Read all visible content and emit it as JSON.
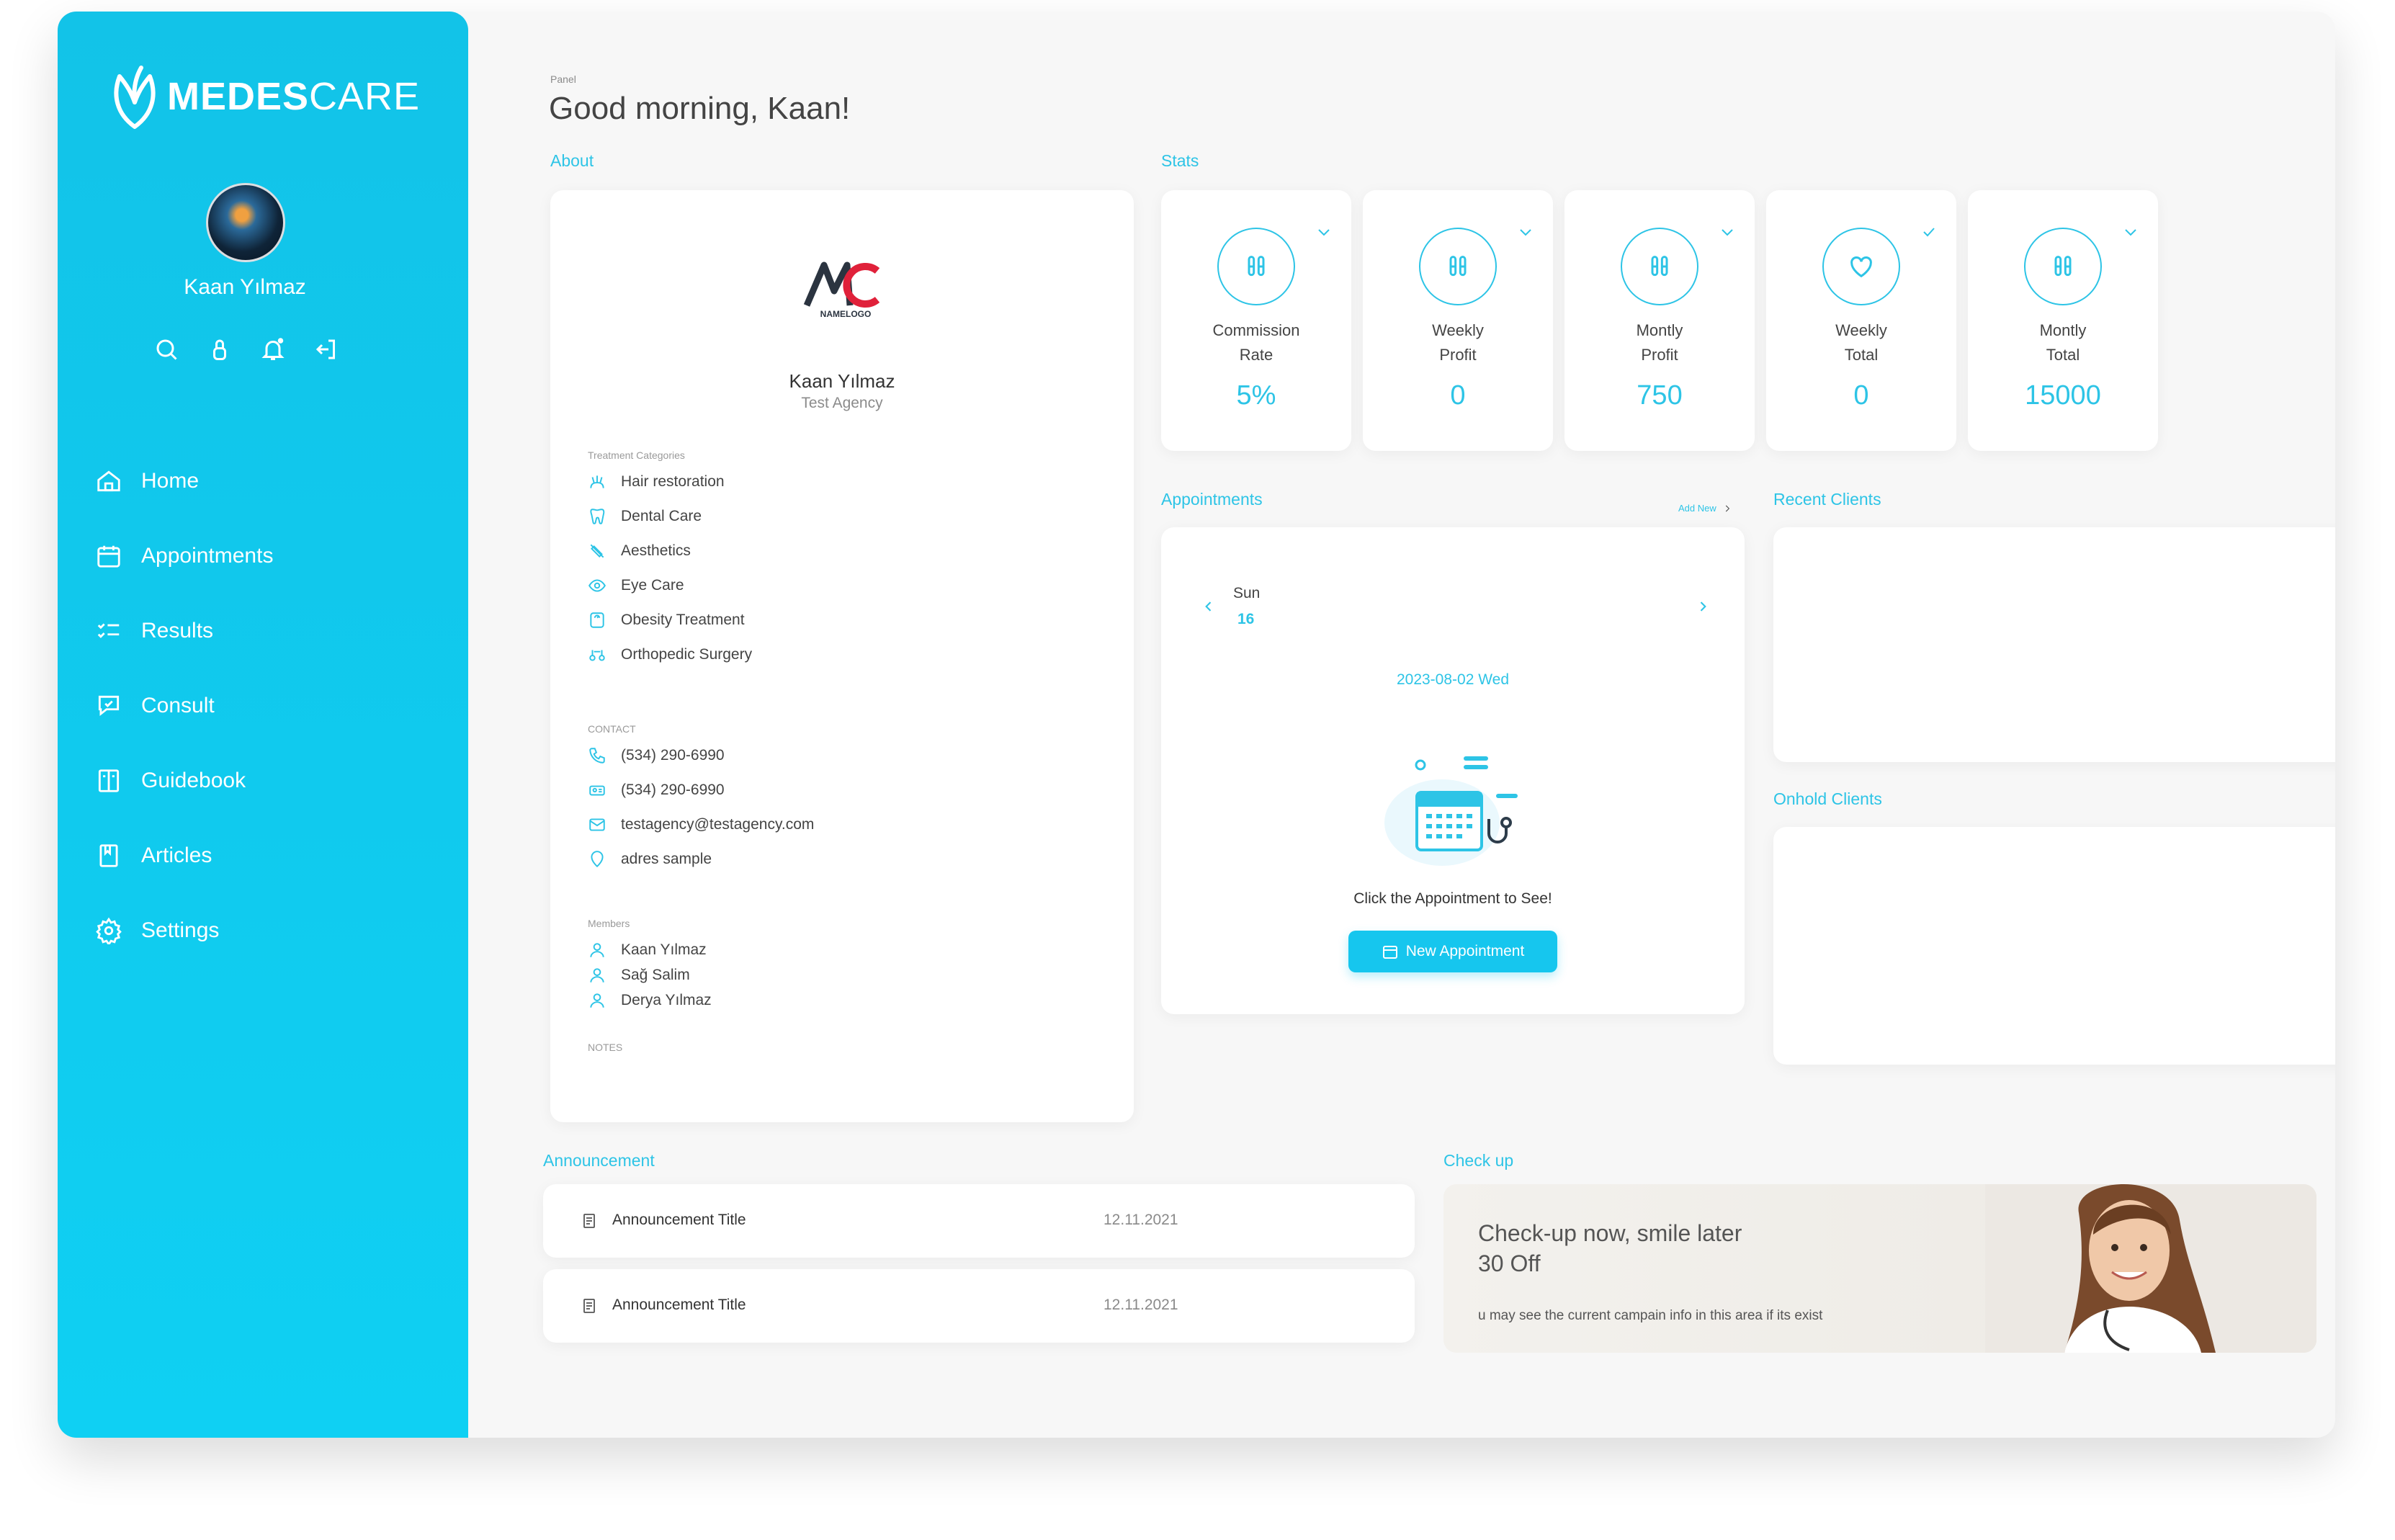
{
  "brand": {
    "name_bold": "MEDES",
    "name_light": "CARE",
    "color": "#12c3e8"
  },
  "user": {
    "name": "Kaan Yılmaz"
  },
  "quick_icons": [
    "search-icon",
    "lock-icon",
    "bell-icon",
    "logout-icon"
  ],
  "nav": [
    {
      "label": "Home",
      "icon": "home-icon"
    },
    {
      "label": "Appointments",
      "icon": "calendar-icon"
    },
    {
      "label": "Results",
      "icon": "list-check-icon"
    },
    {
      "label": "Consult",
      "icon": "chat-icon"
    },
    {
      "label": "Guidebook",
      "icon": "book-icon"
    },
    {
      "label": "Articles",
      "icon": "article-icon"
    },
    {
      "label": "Settings",
      "icon": "gear-icon"
    }
  ],
  "header": {
    "breadcrumb": "Panel",
    "greeting": "Good morning, Kaan!"
  },
  "about": {
    "label": "About",
    "logo_text": "NAMELOGO",
    "name": "Kaan Yılmaz",
    "agency": "Test Agency",
    "categories_label": "Treatment Categories",
    "categories": [
      "Hair restoration",
      "Dental Care",
      "Aesthetics",
      "Eye Care",
      "Obesity Treatment",
      "Orthopedic Surgery"
    ],
    "contact_label": "CONTACT",
    "contact": [
      "(534) 290-6990",
      "(534) 290-6990",
      "testagency@testagency.com",
      "adres sample"
    ],
    "members_label": "Members",
    "members": [
      "Kaan Yılmaz",
      "Sağ Salim",
      "Derya Yılmaz"
    ],
    "notes_label": "NOTES"
  },
  "stats": {
    "label": "Stats",
    "items": [
      {
        "label1": "Commission",
        "label2": "Rate",
        "value": "5%",
        "icon": "vial-icon"
      },
      {
        "label1": "Weekly",
        "label2": "Profit",
        "value": "0",
        "icon": "vial-icon"
      },
      {
        "label1": "Montly",
        "label2": "Profit",
        "value": "750",
        "icon": "vial-icon"
      },
      {
        "label1": "Weekly",
        "label2": "Total",
        "value": "0",
        "icon": "heart-icon"
      },
      {
        "label1": "Montly",
        "label2": "Total",
        "value": "15000",
        "icon": "vial-icon"
      }
    ]
  },
  "appointments": {
    "label": "Appointments",
    "add_new": "Add New",
    "day_name": "Sun",
    "day_num": "16",
    "date": "2023-08-02 Wed",
    "hint": "Click the Appointment to See!",
    "button": "New Appointment"
  },
  "recent_clients": {
    "label": "Recent Clients"
  },
  "onhold_clients": {
    "label": "Onhold Clients"
  },
  "announcements": {
    "label": "Announcement",
    "items": [
      {
        "title": "Announcement Title",
        "date": "12.11.2021"
      },
      {
        "title": "Announcement Title",
        "date": "12.11.2021"
      }
    ]
  },
  "checkup": {
    "label": "Check up",
    "title": "Check-up now, smile later",
    "offer": "30 Off",
    "text": "u may see the current campain info in this area if its exist"
  },
  "colors": {
    "accent": "#2dc4e6",
    "sidebar": "#12c3e8",
    "background": "#f7f7f7"
  }
}
